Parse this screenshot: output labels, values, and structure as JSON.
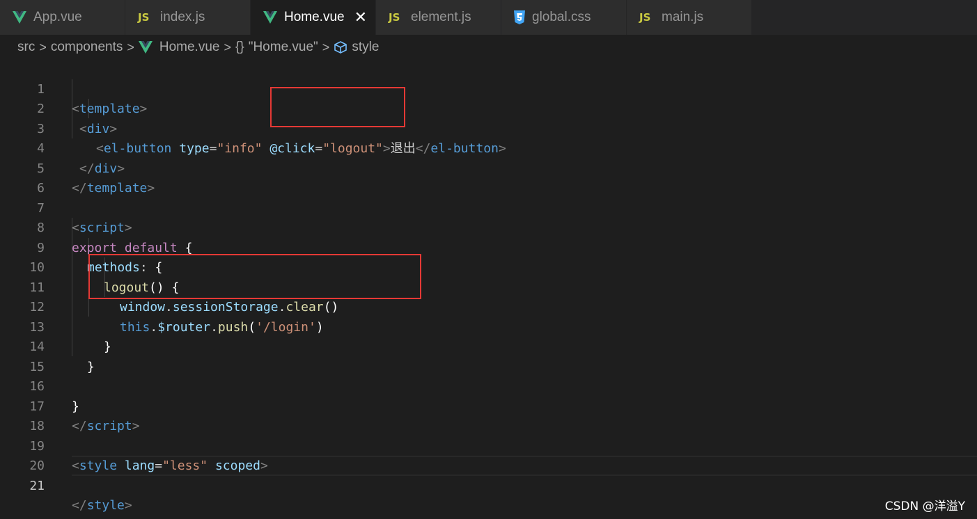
{
  "tabs": [
    {
      "label": "App.vue",
      "icon": "vue-icon"
    },
    {
      "label": "index.js",
      "icon": "js-icon",
      "icon_text": "JS"
    },
    {
      "label": "Home.vue",
      "icon": "vue-icon",
      "active": true,
      "close": "✕"
    },
    {
      "label": "element.js",
      "icon": "js-icon",
      "icon_text": "JS"
    },
    {
      "label": "global.css",
      "icon": "css-icon"
    },
    {
      "label": "main.js",
      "icon": "js-icon",
      "icon_text": "JS"
    }
  ],
  "breadcrumb": {
    "src": "src",
    "components": "components",
    "file": "Home.vue",
    "braces": "{}",
    "module": "\"Home.vue\"",
    "section": "style",
    "separator": ">"
  },
  "editor": {
    "line_numbers": [
      "1",
      "2",
      "3",
      "4",
      "5",
      "6",
      "7",
      "8",
      "9",
      "10",
      "11",
      "12",
      "13",
      "14",
      "15",
      "16",
      "17",
      "18",
      "19",
      "20",
      "21"
    ],
    "current_line": "21",
    "tokens": {
      "lt": "<",
      "gt": ">",
      "lt_slash": "</",
      "template": "template",
      "div": "div",
      "el_button": "el-button",
      "type_attr": "type",
      "eq": "=",
      "info_val": "\"info\"",
      "click_attr": "@click",
      "logout_val": "\"logout\"",
      "button_text": "退出",
      "script": "script",
      "export": "export",
      "default": "default",
      "open_brace": "{",
      "close_brace": "}",
      "methods": "methods",
      "colon": ":",
      "logout": "logout",
      "parens": "()",
      "window": "window",
      "dot": ".",
      "sessionStorage": "sessionStorage",
      "clear": "clear",
      "this": "this",
      "router": "$router",
      "push": "push",
      "open_paren": "(",
      "close_paren": ")",
      "login_path": "'/login'",
      "style": "style",
      "lang_attr": "lang",
      "less_val": "\"less\"",
      "scoped": "scoped"
    }
  },
  "watermark": "CSDN @洋溢Y",
  "colors": {
    "highlight_box": "#e53935",
    "vue_green": "#41b883",
    "js_yellow": "#cbcb41",
    "css_blue": "#42a5f5"
  }
}
